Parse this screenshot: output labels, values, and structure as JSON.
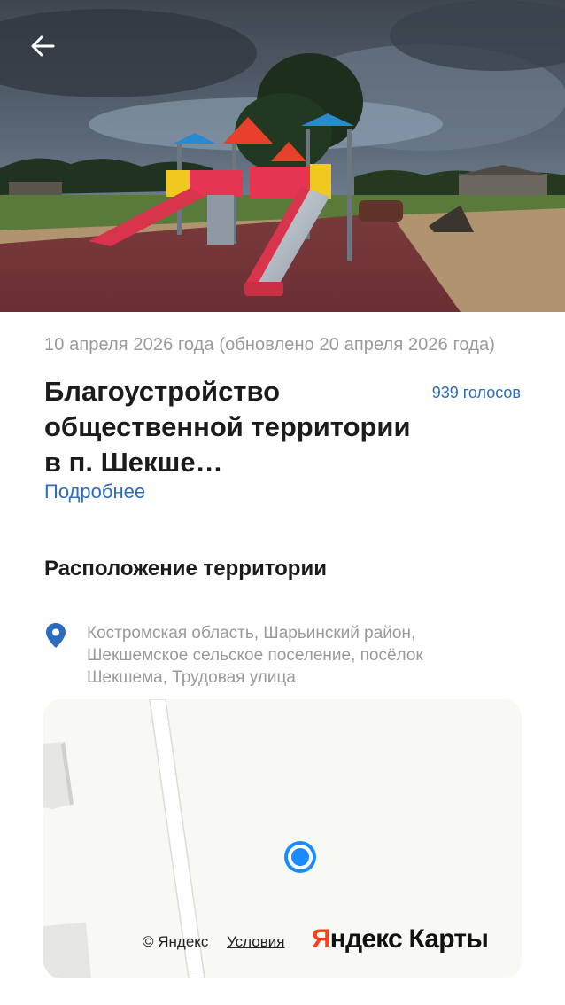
{
  "header": {
    "back_icon": "arrow-left-icon",
    "photo_icon": "playground-photo"
  },
  "project": {
    "date": "10 апреля 2026 года (обновлено 20 апреля 2026 года)",
    "title": "Благоустройство общественной территории в п. Шекше…",
    "votes": "939 голосов",
    "more_link": "Подробнее"
  },
  "location": {
    "section_title": "Расположение территории",
    "pin_icon": "location-pin-icon",
    "address": "Костромская область, Шарьинский район, Шекшемское сельское поселение, посёлок Шекшема, Трудовая улица"
  },
  "map": {
    "copyright": "© Яндекс",
    "terms": "Условия",
    "logo_part1": "Я",
    "logo_part2": "ндекс Карты",
    "marker_icon": "current-location-marker-icon"
  },
  "colors": {
    "link": "#2d6bc0",
    "marker": "#1a8cff",
    "yandex_red": "#fc3f1d"
  }
}
